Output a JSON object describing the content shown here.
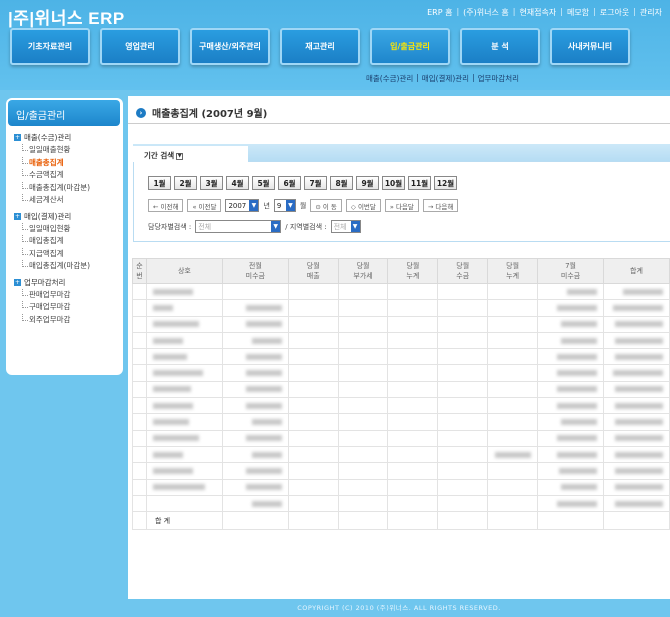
{
  "header": {
    "logo": "|주|위너스 ERP",
    "links": [
      "ERP 홈",
      "(주)위너스 홈",
      "현재접속자",
      "메모함",
      "로그아웃",
      "관리자"
    ],
    "nav": [
      {
        "label": "기초자료관리",
        "active": false
      },
      {
        "label": "영업관리",
        "active": false
      },
      {
        "label": "구매생산/외주관리",
        "active": false
      },
      {
        "label": "재고관리",
        "active": false
      },
      {
        "label": "입/출금관리",
        "active": true
      },
      {
        "label": "분  석",
        "active": false
      },
      {
        "label": "사내커뮤니티",
        "active": false
      }
    ],
    "subnav": [
      "매출(수금)관리",
      "매입(결제)관리",
      "업무마감처리"
    ]
  },
  "sidebar": {
    "title": "입/출금관리",
    "groups": [
      {
        "label": "매출(수금)관리",
        "items": [
          "일일매출현황",
          "매출총집계",
          "수금액집계",
          "매출총집계(마감분)",
          "세금계산서"
        ]
      },
      {
        "label": "매입(결제)관리",
        "items": [
          "일일매입현황",
          "매입총집계",
          "지급액집계",
          "매입총집계(마감분)"
        ]
      },
      {
        "label": "업무마감처리",
        "items": [
          "판매업무마감",
          "구매업무마감",
          "외주업무마감"
        ]
      }
    ],
    "active_item": "매출총집계"
  },
  "main": {
    "title": "매출총집계 (2007년 9월)",
    "search_tab": "기간 검색",
    "months": [
      "1월",
      "2월",
      "3월",
      "4월",
      "5월",
      "6월",
      "7월",
      "8월",
      "9월",
      "10월",
      "11월",
      "12월"
    ],
    "prev_year": "← 이전해",
    "prev_month": "« 이전달",
    "year_value": "2007",
    "year_suffix": "년",
    "month_value": "9",
    "month_suffix": "월",
    "move": "⊙ 이 동",
    "this_month": "◇ 이번달",
    "next_month": "» 다음달",
    "next_year": "→ 다음해",
    "staff_label": "담당자별검색 :",
    "staff_value": "전체",
    "region_label": "/ 지역별검색 :",
    "region_value": "전체",
    "columns": [
      "순\n번",
      "상호",
      "전월\n미수금",
      "당월\n매출",
      "당월\n부가세",
      "당월\n누계",
      "당월\n수금",
      "당월\n누계",
      "7월\n미수금",
      "합계"
    ],
    "total_label": "합 계"
  },
  "footer": "COPYRIGHT (C) 2010 (주)위너스. ALL RIGHTS RESERVED.",
  "colors": {
    "accent": "#1d86cc",
    "active_nav": "#ffe600",
    "active_item": "#e85a00"
  }
}
